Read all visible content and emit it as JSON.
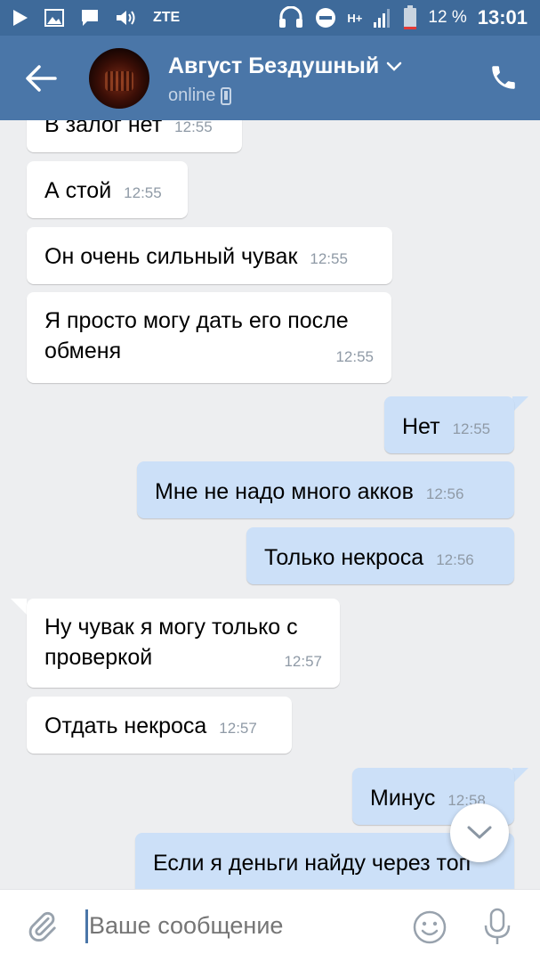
{
  "status_bar": {
    "carrier": "ZTE",
    "network": "H+",
    "battery": "12 %",
    "time": "13:01",
    "icons": [
      "play-icon",
      "image-icon",
      "message-icon",
      "volume-icon",
      "headset-icon",
      "dnd-icon",
      "signal-icon",
      "battery-icon"
    ]
  },
  "header": {
    "contact_name": "Август Бездушный",
    "status": "online",
    "icons": [
      "back-arrow-icon",
      "chevron-down-icon",
      "mobile-icon",
      "phone-icon"
    ]
  },
  "messages": [
    {
      "dir": "in",
      "text": "В залог нет",
      "time": "12:55"
    },
    {
      "dir": "in",
      "text": "А стой",
      "time": "12:55"
    },
    {
      "dir": "in",
      "text": "Он очень сильный чувак",
      "time": "12:55"
    },
    {
      "dir": "in",
      "text": "Я просто могу дать его после обменя",
      "time": "12:55"
    },
    {
      "dir": "out",
      "text": "Нет",
      "time": "12:55"
    },
    {
      "dir": "out",
      "text": "Мне не надо много акков",
      "time": "12:56"
    },
    {
      "dir": "out",
      "text": "Только некроса",
      "time": "12:56"
    },
    {
      "dir": "in",
      "text": "Ну чувак я могу только с проверкой",
      "time": "12:57"
    },
    {
      "dir": "in",
      "text": "Отдать некроса",
      "time": "12:57"
    },
    {
      "dir": "out",
      "text": "Минус",
      "time": "12:58"
    },
    {
      "dir": "out",
      "text": "Если я деньги найду через топ",
      "time": ""
    }
  ],
  "composer": {
    "placeholder": "Ваше сообщение",
    "icons": [
      "paperclip-icon",
      "emoji-icon",
      "microphone-icon"
    ]
  },
  "colors": {
    "statusbar": "#3e6a9a",
    "header": "#4a76a8",
    "background": "#edeef0",
    "incoming_bubble": "#ffffff",
    "outgoing_bubble": "#cce0f8",
    "time_text": "#8f9aa6"
  }
}
